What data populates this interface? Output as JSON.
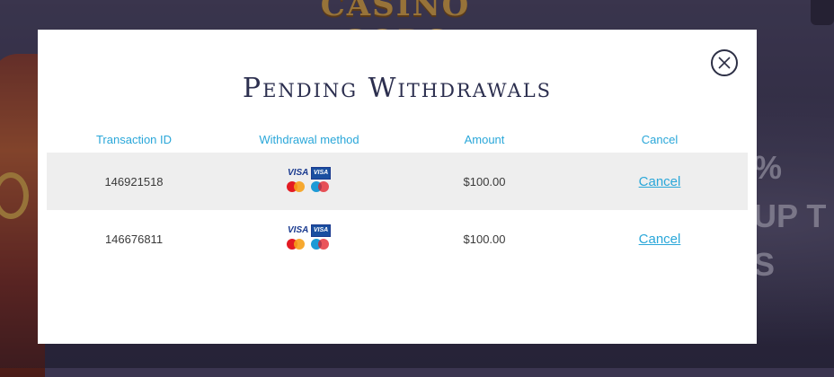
{
  "background": {
    "logo_text": "CASINO GODS",
    "promo_line1": "% UP T",
    "promo_line2": "S"
  },
  "modal": {
    "title": "Pending Withdrawals",
    "close_icon": "close-icon"
  },
  "table": {
    "headers": [
      "Transaction ID",
      "Withdrawal method",
      "Amount",
      "Cancel"
    ],
    "rows": [
      {
        "transaction_id": "146921518",
        "method_icons": [
          "visa",
          "visa-electron",
          "mastercard",
          "maestro"
        ],
        "amount": "$100.00",
        "cancel_label": "Cancel"
      },
      {
        "transaction_id": "146676811",
        "method_icons": [
          "visa",
          "visa-electron",
          "mastercard",
          "maestro"
        ],
        "amount": "$100.00",
        "cancel_label": "Cancel"
      }
    ]
  },
  "payment_icons": {
    "visa_label": "VISA",
    "visa_electron_label": "VISA"
  },
  "colors": {
    "accent": "#2aa7d9",
    "title": "#2c2f4f",
    "row_shade": "#eeeeee"
  }
}
